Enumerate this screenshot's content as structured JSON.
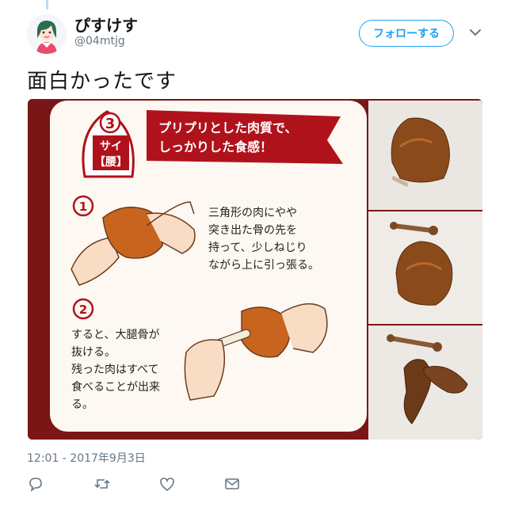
{
  "user": {
    "display_name": "ぴすけす",
    "handle": "@04mtjg",
    "avatar_icon": "girl-avatar-icon"
  },
  "follow_button_label": "フォローする",
  "tweet_text": "面白かったです",
  "timestamp": "12:01 - 2017年9月3日",
  "media": {
    "card": {
      "step_number": "3",
      "part_name": "サイ",
      "part_sub": "【腰】",
      "banner_line1": "プリプリとした肉質で、",
      "banner_line2": "しっかりした食感！",
      "step1_number": "1",
      "step1_lines": [
        "三角形の肉にやや",
        "突き出た骨の先を",
        "持って、少しねじり",
        "ながら上に引っ張る。"
      ],
      "step2_number": "2",
      "step2_lines": [
        "すると、大腿骨が",
        "抜ける。",
        "残った肉はすべて",
        "食べることが出来",
        "る。"
      ]
    }
  },
  "actions": {
    "reply_icon": "reply-icon",
    "retweet_icon": "retweet-icon",
    "like_icon": "heart-icon",
    "dm_icon": "envelope-icon"
  },
  "colors": {
    "accent": "#1da1f2",
    "card_red": "#b0121b",
    "frame_maroon": "#7a1616",
    "chicken_brown": "#b5581c"
  }
}
